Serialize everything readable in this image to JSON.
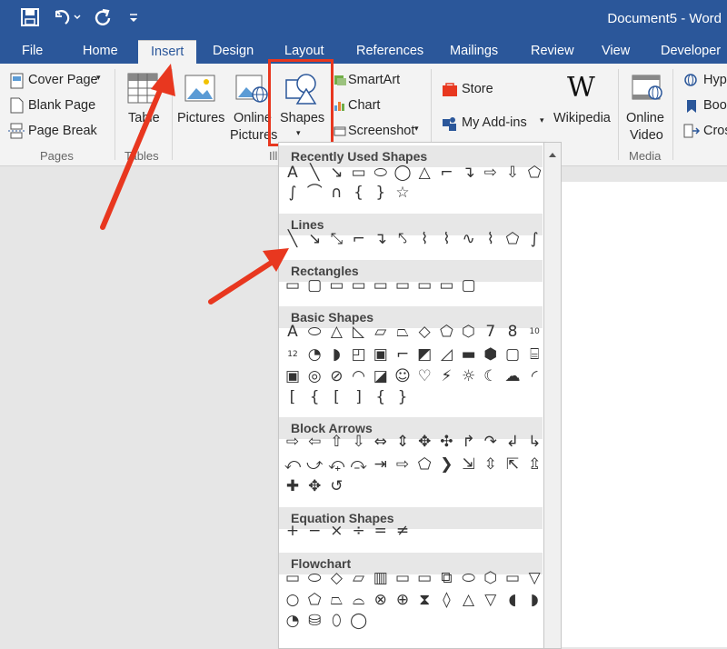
{
  "titlebar": {
    "title": "Document5  -  Word"
  },
  "tabs": [
    "File",
    "Home",
    "Insert",
    "Design",
    "Layout",
    "References",
    "Mailings",
    "Review",
    "View",
    "Developer"
  ],
  "ribbon": {
    "cover_page": "Cover Page",
    "blank_page": "Blank Page",
    "page_break": "Page Break",
    "pages_group": "Pages",
    "table": "Table",
    "tables_group": "Tables",
    "pictures": "Pictures",
    "online_pictures_1": "Online",
    "online_pictures_2": "Pictures",
    "shapes": "Shapes",
    "illustrations_group": "Ill",
    "smartart": "SmartArt",
    "chart": "Chart",
    "screenshot": "Screenshot",
    "store": "Store",
    "my_addins": "My Add-ins",
    "wikipedia": "Wikipedia",
    "online_video_1": "Online",
    "online_video_2": "Video",
    "media_group": "Media",
    "hyperlink": "Hyp",
    "bookmark": "Boo",
    "crossref": "Cros"
  },
  "sections": {
    "recent": "Recently Used Shapes",
    "lines": "Lines",
    "rectangles": "Rectangles",
    "basic": "Basic Shapes",
    "block_arrows": "Block Arrows",
    "equation": "Equation Shapes",
    "flowchart": "Flowchart"
  },
  "glyphs": {
    "recent_row1": [
      "A",
      "╲",
      "↘",
      "▭",
      "⬭",
      "◯",
      "△",
      "⌐",
      "↴",
      "⇨",
      "⇩",
      "⬠"
    ],
    "recent_row2": [
      "∫",
      "⌒",
      "∩",
      "{",
      "}",
      "☆"
    ],
    "lines_row": [
      "╲",
      "↘",
      "⤡",
      "⌐",
      "↴",
      "⤣",
      "⌇",
      "⌇",
      "∿",
      "⌇",
      "⬠",
      "∫"
    ],
    "rect_row": [
      "▭",
      "▢",
      "▭",
      "▭",
      "▭",
      "▭",
      "▭",
      "▭",
      "▢"
    ],
    "basic_row1": [
      "A",
      "⬭",
      "△",
      "◺",
      "▱",
      "⏢",
      "◇",
      "⬠",
      "⬡",
      "7",
      "8",
      "10"
    ],
    "basic_row2": [
      "12",
      "◔",
      "◗",
      "◰",
      "▣",
      "⌐",
      "◩",
      "◿",
      "▬",
      "⬢",
      "▢",
      "⌸"
    ],
    "basic_row3": [
      "▣",
      "◎",
      "⊘",
      "◠",
      "◪",
      "☺",
      "♡",
      "⚡",
      "☼",
      "☾",
      "☁",
      "◜"
    ],
    "basic_row4": [
      "[",
      "{",
      "[",
      "]",
      "{",
      "}"
    ],
    "arrows_row1": [
      "⇨",
      "⇦",
      "⇧",
      "⇩",
      "⇔",
      "⇕",
      "✥",
      "✣",
      "↱",
      "↷",
      "↲",
      "↳"
    ],
    "arrows_row2": [
      "⤺",
      "⤻",
      "⤽",
      "⤼",
      "⇥",
      "⇨",
      "⬠",
      "❯",
      "⇲",
      "⇳",
      "⇱",
      "⇫"
    ],
    "arrows_row3": [
      "✚",
      "✥",
      "↺"
    ],
    "equation_row": [
      "+",
      "−",
      "×",
      "÷",
      "=",
      "≠"
    ],
    "flow_row1": [
      "▭",
      "⬭",
      "◇",
      "▱",
      "▥",
      "▭",
      "▭",
      "⧉",
      "⬭",
      "⬡",
      "▭",
      "▽"
    ],
    "flow_row2": [
      "○",
      "⬠",
      "⏢",
      "⌓",
      "⊗",
      "⊕",
      "⧗",
      "◊",
      "△",
      "▽",
      "◖",
      "◗"
    ],
    "flow_row3": [
      "◔",
      "⛁",
      "⬯",
      "◯"
    ]
  },
  "colors": {
    "brand": "#2b579a",
    "annotation_red": "#e8371f"
  }
}
